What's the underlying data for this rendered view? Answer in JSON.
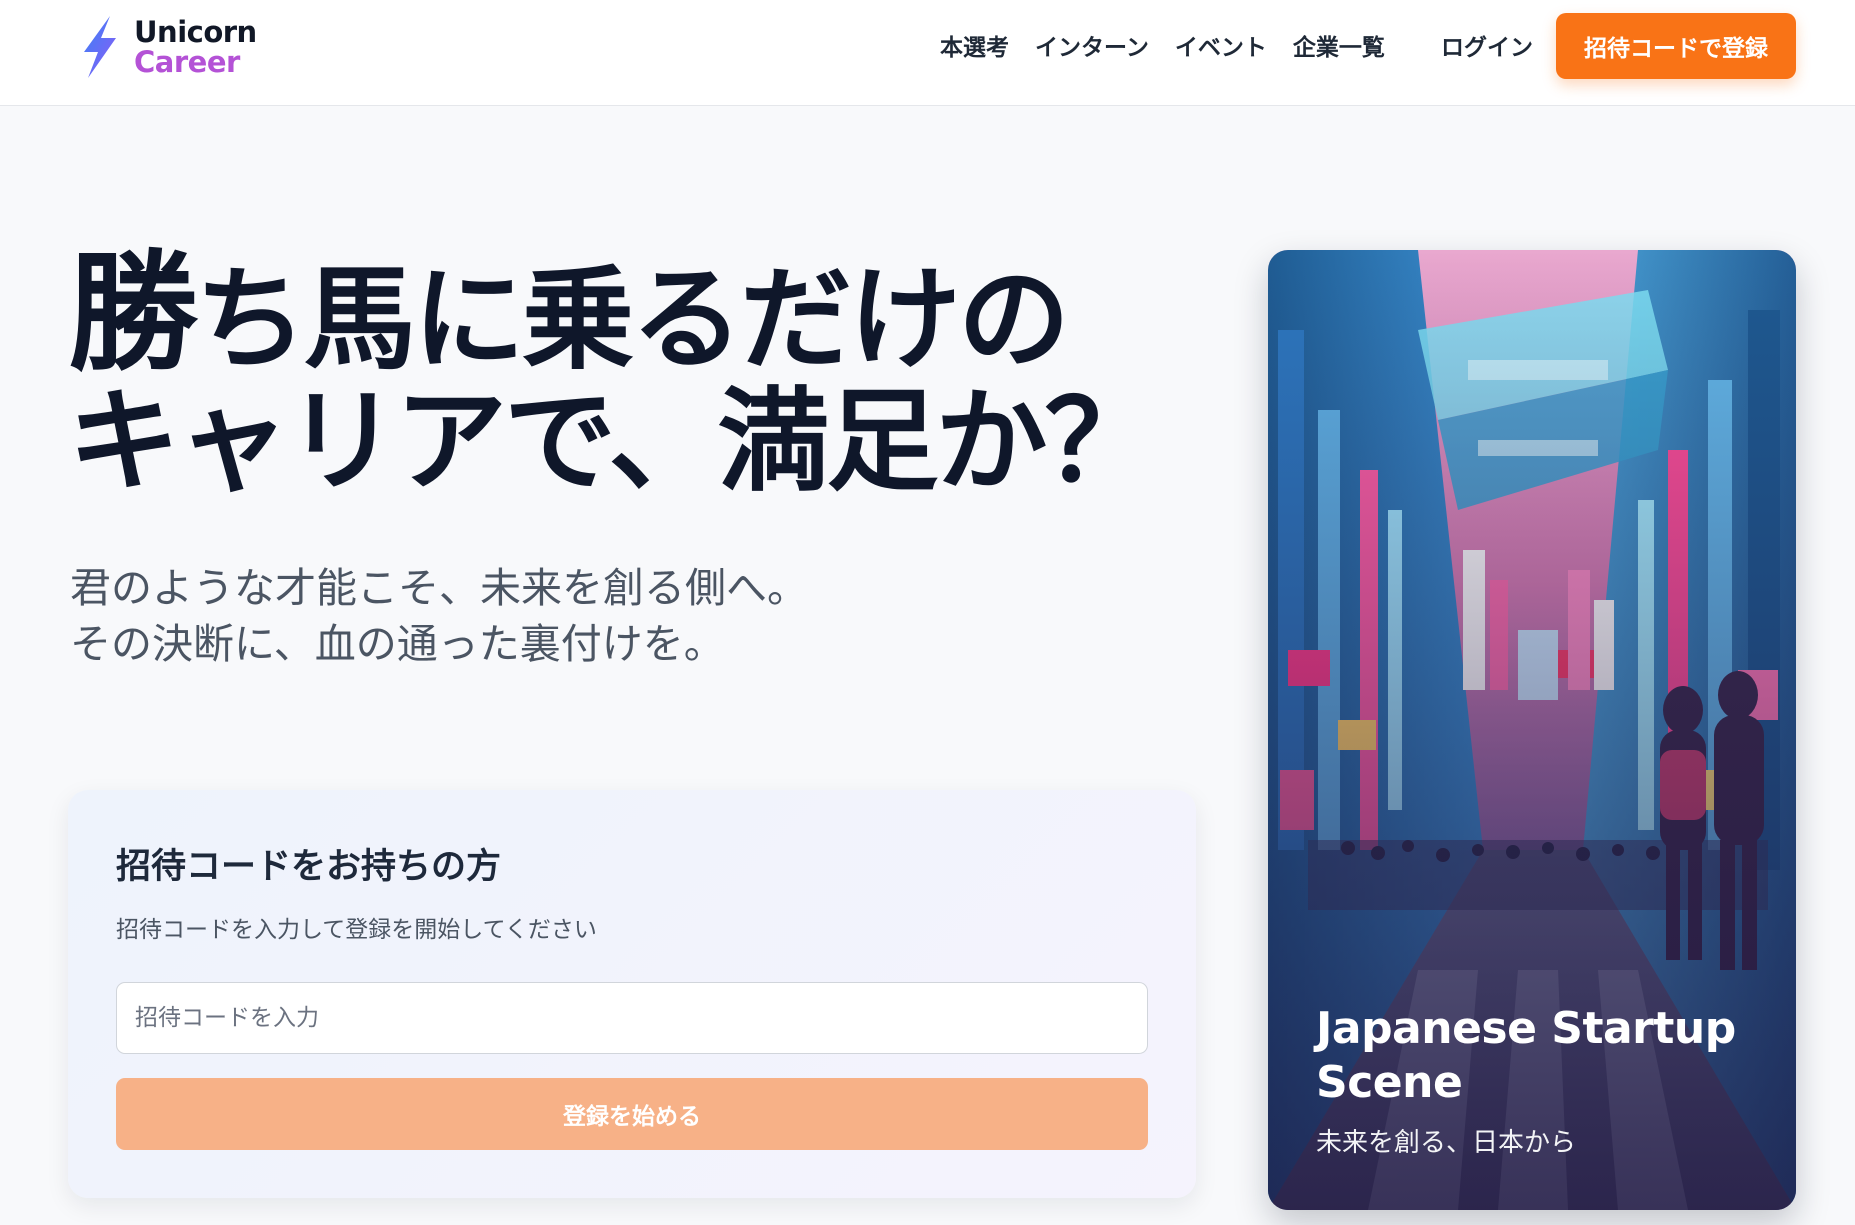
{
  "brand": {
    "name_line1": "Unicorn",
    "name_line2": "Career",
    "logo_icon": "lightning-bolt-icon",
    "accent_color": "#f97316",
    "brand_purple": "#b452d6"
  },
  "nav": {
    "items": [
      {
        "label": "本選考"
      },
      {
        "label": "インターン"
      },
      {
        "label": "イベント"
      },
      {
        "label": "企業一覧"
      }
    ],
    "login_label": "ログイン",
    "register_label": "招待コードで登録"
  },
  "hero": {
    "headline_first_char": "勝",
    "headline_line1_rest": "ち馬に乗るだけの",
    "headline_line2": "キャリアで、満足か？",
    "subline_1": "君のような才能こそ、未来を創る側へ。",
    "subline_2": "その決断に、血の通った裏付けを。"
  },
  "invite": {
    "title": "招待コードをお持ちの方",
    "description": "招待コードを入力して登録を開始してください",
    "input_placeholder": "招待コードを入力",
    "input_value": "",
    "submit_label": "登録を始める"
  },
  "feature_card": {
    "title": "Japanese Startup Scene",
    "subtitle": "未来を創る、日本から"
  }
}
